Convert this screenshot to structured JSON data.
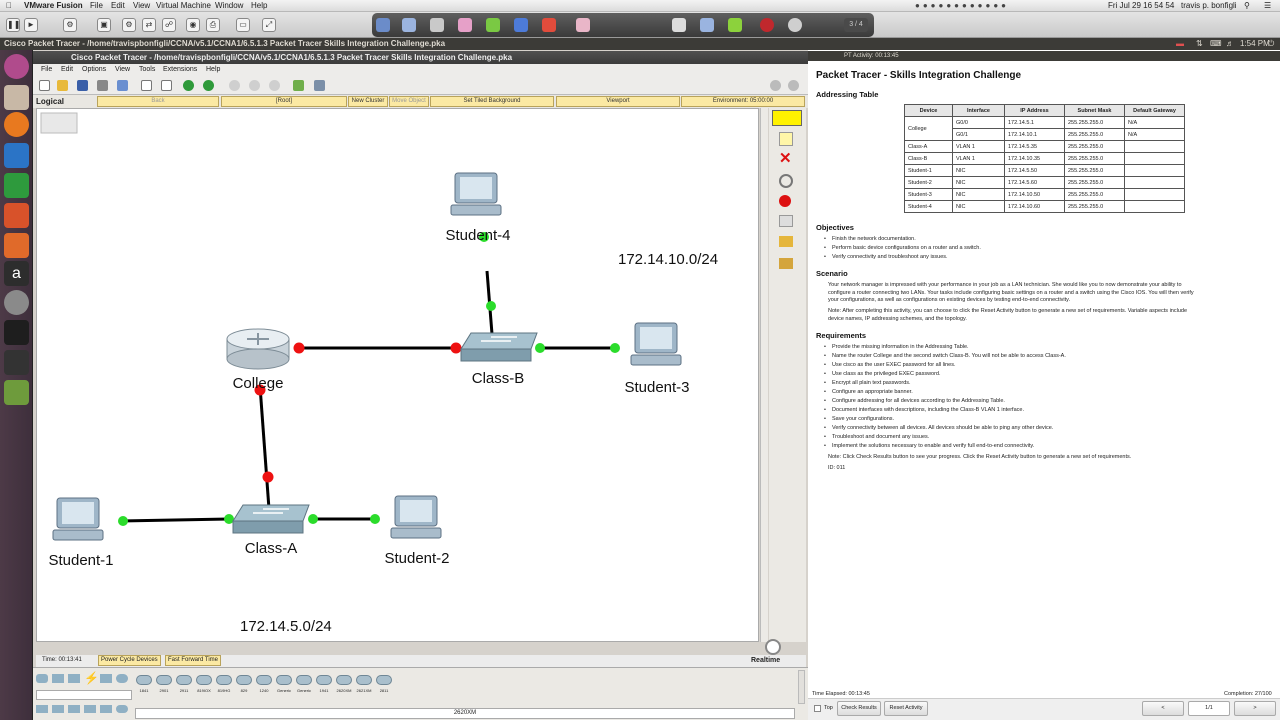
{
  "mac_menubar": {
    "app": "VMware Fusion",
    "menus": [
      "File",
      "Edit",
      "View",
      "Virtual Machine",
      "Window",
      "Help"
    ],
    "clock": "Fri Jul 29 16 54 54",
    "user": "travis p. bonfigli"
  },
  "vm_toolbar": {
    "vm_label": "3 / 4"
  },
  "ubuntu_topbar": {
    "time": "1:54 PM"
  },
  "packet_tracer": {
    "outer_title": "Cisco Packet Tracer - /home/travispbonfigli/CCNA/v5.1/CCNA1/6.5.1.3 Packet Tracer Skills Integration Challenge.pka",
    "window_title": "Cisco Packet Tracer - /home/travispbonfigli/CCNA/v5.1/CCNA1/6.5.1.3 Packet Tracer Skills Integration Challenge.pka",
    "menus": [
      "File",
      "Edit",
      "Options",
      "View",
      "Tools",
      "Extensions",
      "Help"
    ],
    "nav": {
      "logical": "Logical",
      "back": "Back",
      "root": "[Root]",
      "new_cluster": "New Cluster",
      "move_object": "Move Object",
      "tiled_bg": "Set Tiled Background",
      "viewport": "Viewport",
      "environment": "Environment: 05:00:00"
    },
    "topology": {
      "devices": {
        "student4": "Student-4",
        "college": "College",
        "classb": "Class-B",
        "student3": "Student-3",
        "student1": "Student-1",
        "classa": "Class-A",
        "student2": "Student-2"
      },
      "subnets": {
        "top": "172.14.10.0/24",
        "bottom": "172.14.5.0/24"
      }
    },
    "timebar": {
      "time": "Time: 00:13:41",
      "power_cycle": "Power Cycle Devices",
      "fast_forward": "Fast Forward Time",
      "mode": "Realtime"
    },
    "device_panel": {
      "models": [
        "1841",
        "2901",
        "2911",
        "819IOX",
        "819HG",
        "829",
        "1240",
        "Generic",
        "Generic",
        "1941",
        "2620XM",
        "2621XM",
        "2811"
      ],
      "selected_model": "2620XM"
    }
  },
  "activity": {
    "window_title": "PT Activity: 00:13:45",
    "title": "Packet Tracer - Skills Integration Challenge",
    "addressing_heading": "Addressing Table",
    "table_headers": [
      "Device",
      "Interface",
      "IP Address",
      "Subnet Mask",
      "Default Gateway"
    ],
    "table_rows": [
      [
        "College",
        "G0/0",
        "172.14.5.1",
        "255.255.255.0",
        "N/A"
      ],
      [
        "",
        "G0/1",
        "172.14.10.1",
        "255.255.255.0",
        "N/A"
      ],
      [
        "Class-A",
        "VLAN 1",
        "172.14.5.35",
        "255.255.255.0",
        ""
      ],
      [
        "Class-B",
        "VLAN 1",
        "172.14.10.35",
        "255.255.255.0",
        ""
      ],
      [
        "Student-1",
        "NIC",
        "172.14.5.50",
        "255.255.255.0",
        ""
      ],
      [
        "Student-2",
        "NIC",
        "172.14.5.60",
        "255.255.255.0",
        ""
      ],
      [
        "Student-3",
        "NIC",
        "172.14.10.50",
        "255.255.255.0",
        ""
      ],
      [
        "Student-4",
        "NIC",
        "172.14.10.60",
        "255.255.255.0",
        ""
      ]
    ],
    "objectives_heading": "Objectives",
    "objectives": [
      "Finish the network documentation.",
      "Perform basic device configurations on a router and a switch.",
      "Verify connectivity and troubleshoot any issues."
    ],
    "scenario_heading": "Scenario",
    "scenario_lines": [
      "Your network manager is impressed with your performance in your job as a LAN technician. She would like you to now demonstrate your ability to",
      "configure a router connecting two LANs. Your tasks include configuring basic settings on a router and a switch using the Cisco IOS. You will then verify",
      "your configurations, as well as configurations on existing devices by testing end-to-end connectivity."
    ],
    "note_lines": [
      "Note: After completing this activity, you can choose to click the Reset Activity button to generate a new set of requirements. Variable aspects include",
      "device names, IP addressing schemes, and the topology."
    ],
    "requirements_heading": "Requirements",
    "requirements": [
      "Provide the missing information in the Addressing Table.",
      "Name the router College and the second switch Class-B. You will not be able to access Class-A.",
      "Use cisco as the user EXEC password for all lines.",
      "Use class as the privileged EXEC password.",
      "Encrypt all plain text passwords.",
      "Configure an appropriate banner.",
      "Configure addressing for all devices according to the Addressing Table.",
      "Document interfaces with descriptions, including the Class-B VLAN 1 interface.",
      "Save your configurations.",
      "Verify connectivity between all devices. All devices should be able to ping any other device.",
      "Troubleshoot and document any issues.",
      "Implement the solutions necessary to enable and verify full end-to-end connectivity."
    ],
    "final_note": "Note: Click Check Results button to see your progress. Click the Reset Activity button to generate a new set of requirements.",
    "id_line": "ID: 011",
    "elapsed": "Time Elapsed: 00:13:45",
    "completion": "Completion: 27/100",
    "top_label": "Top",
    "check_results": "Check Results",
    "reset_activity": "Reset Activity",
    "page": "1/1",
    "prev": "<",
    "next": ">"
  }
}
